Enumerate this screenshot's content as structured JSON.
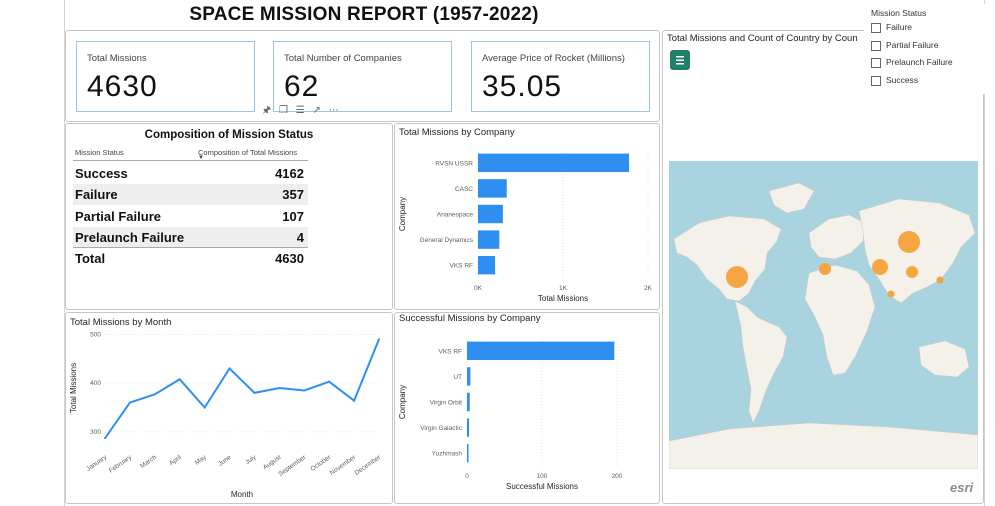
{
  "report": {
    "title": "SPACE MISSION REPORT (1957-2022)"
  },
  "cards": [
    {
      "label": "Total Missions",
      "value": "4630"
    },
    {
      "label": "Total Number of Companies",
      "value": "62"
    },
    {
      "label": "Average Price of Rocket (Millions)",
      "value": "35.05"
    }
  ],
  "toolbar": {
    "icons": [
      "pin-icon",
      "copy-icon",
      "filter-icon",
      "focus-mode-icon",
      "more-options-icon"
    ]
  },
  "status_table": {
    "title": "Composition of Mission Status",
    "col_status": "Mission Status",
    "col_composition": "Composition of Total Missions",
    "rows": [
      {
        "status": "Success",
        "value": "4162"
      },
      {
        "status": "Failure",
        "value": "357"
      },
      {
        "status": "Partial Failure",
        "value": "107"
      },
      {
        "status": "Prelaunch Failure",
        "value": "4"
      }
    ],
    "total_label": "Total",
    "total_value": "4630"
  },
  "slicer": {
    "title": "Mission Status",
    "options": [
      "Failure",
      "Partial Failure",
      "Prelaunch Failure",
      "Success"
    ]
  },
  "map_visual": {
    "title": "Total Missions and Count of Country by Coun",
    "attribution": "esri",
    "bubble_color": "#f5a03a"
  },
  "colors": {
    "bar": "#2e8ff0",
    "line": "#2e8ff0",
    "card_border": "#9ec3e6"
  },
  "chart_data": [
    {
      "type": "bar",
      "orientation": "horizontal",
      "title": "Total Missions by Company",
      "categories": [
        "RVSN USSR",
        "CASC",
        "Arianespace",
        "General Dynamics",
        "VKS RF"
      ],
      "values": [
        1777,
        338,
        293,
        251,
        201
      ],
      "xlabel": "Total Missions",
      "ylabel": "Company",
      "xticks": [
        "0K",
        "1K",
        "2K"
      ],
      "xlim": [
        0,
        2000
      ]
    },
    {
      "type": "line",
      "title": "Total Missions by Month",
      "x": [
        "January",
        "February",
        "March",
        "April",
        "May",
        "June",
        "July",
        "August",
        "September",
        "October",
        "November",
        "December"
      ],
      "values": [
        287,
        360,
        377,
        408,
        350,
        430,
        380,
        390,
        385,
        403,
        364,
        490
      ],
      "xlabel": "Month",
      "ylabel": "Total Missions",
      "yticks": [
        "300",
        "400",
        "500"
      ],
      "ylim": [
        275,
        505
      ]
    },
    {
      "type": "bar",
      "orientation": "horizontal",
      "title": "Successful Missions by Company",
      "categories": [
        "VKS RF",
        "UT",
        "Virgin Orbit",
        "Virgin Galactic",
        "Yuzhmash"
      ],
      "values": [
        216,
        5,
        4,
        3,
        2
      ],
      "xlabel": "Successful Missions",
      "ylabel": "Company",
      "xticks": [
        "0",
        "100",
        "200"
      ],
      "xlim": [
        0,
        220
      ]
    }
  ]
}
